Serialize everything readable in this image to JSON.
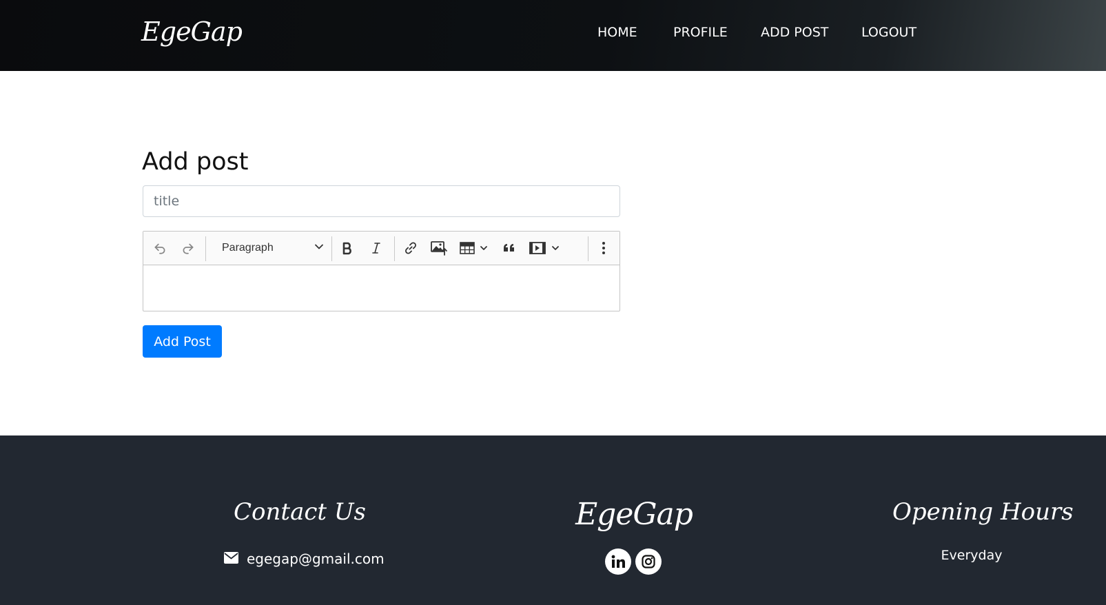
{
  "header": {
    "brand": "EgeGap",
    "nav": [
      {
        "label": "HOME"
      },
      {
        "label": "PROFILE"
      },
      {
        "label": "ADD POST"
      },
      {
        "label": "LOGOUT"
      }
    ]
  },
  "main": {
    "title": "Add post",
    "title_input": {
      "placeholder": "title",
      "value": ""
    },
    "editor": {
      "toolbar": {
        "heading_select": "Paragraph",
        "icons": [
          "undo-icon",
          "redo-icon",
          "bold-icon",
          "italic-icon",
          "link-icon",
          "insert-image-icon",
          "insert-table-icon",
          "block-quote-icon",
          "insert-media-icon",
          "more-options-icon"
        ]
      },
      "content": ""
    },
    "submit_label": "Add Post"
  },
  "footer": {
    "contact": {
      "heading": "Contact Us",
      "email": "egegap@gmail.com",
      "icon": "envelope-icon"
    },
    "brand": {
      "name": "EgeGap",
      "social": [
        "linkedin-icon",
        "instagram-icon"
      ]
    },
    "hours": {
      "heading": "Opening Hours",
      "text": "Everyday"
    }
  },
  "colors": {
    "primary": "#007bff",
    "footer_bg": "#222831",
    "header_bg": "#0d1013"
  }
}
